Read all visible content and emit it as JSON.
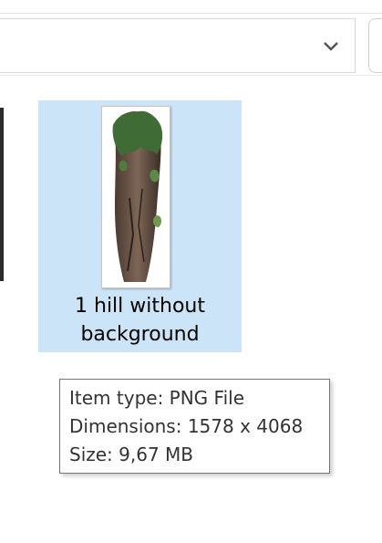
{
  "explorer": {
    "selected_item": {
      "name": "1 hill without background",
      "thumbnail": "rock-pillar-thumbnail"
    },
    "tooltip": {
      "item_type": "Item type: PNG File",
      "dimensions": "Dimensions: 1578 x 4068",
      "size": "Size: 9,67 MB"
    },
    "address_bar": {
      "dropdown_icon": "chevron-down-icon"
    },
    "colors": {
      "selection_bg": "#cce4f7",
      "tooltip_border": "#767676"
    }
  }
}
